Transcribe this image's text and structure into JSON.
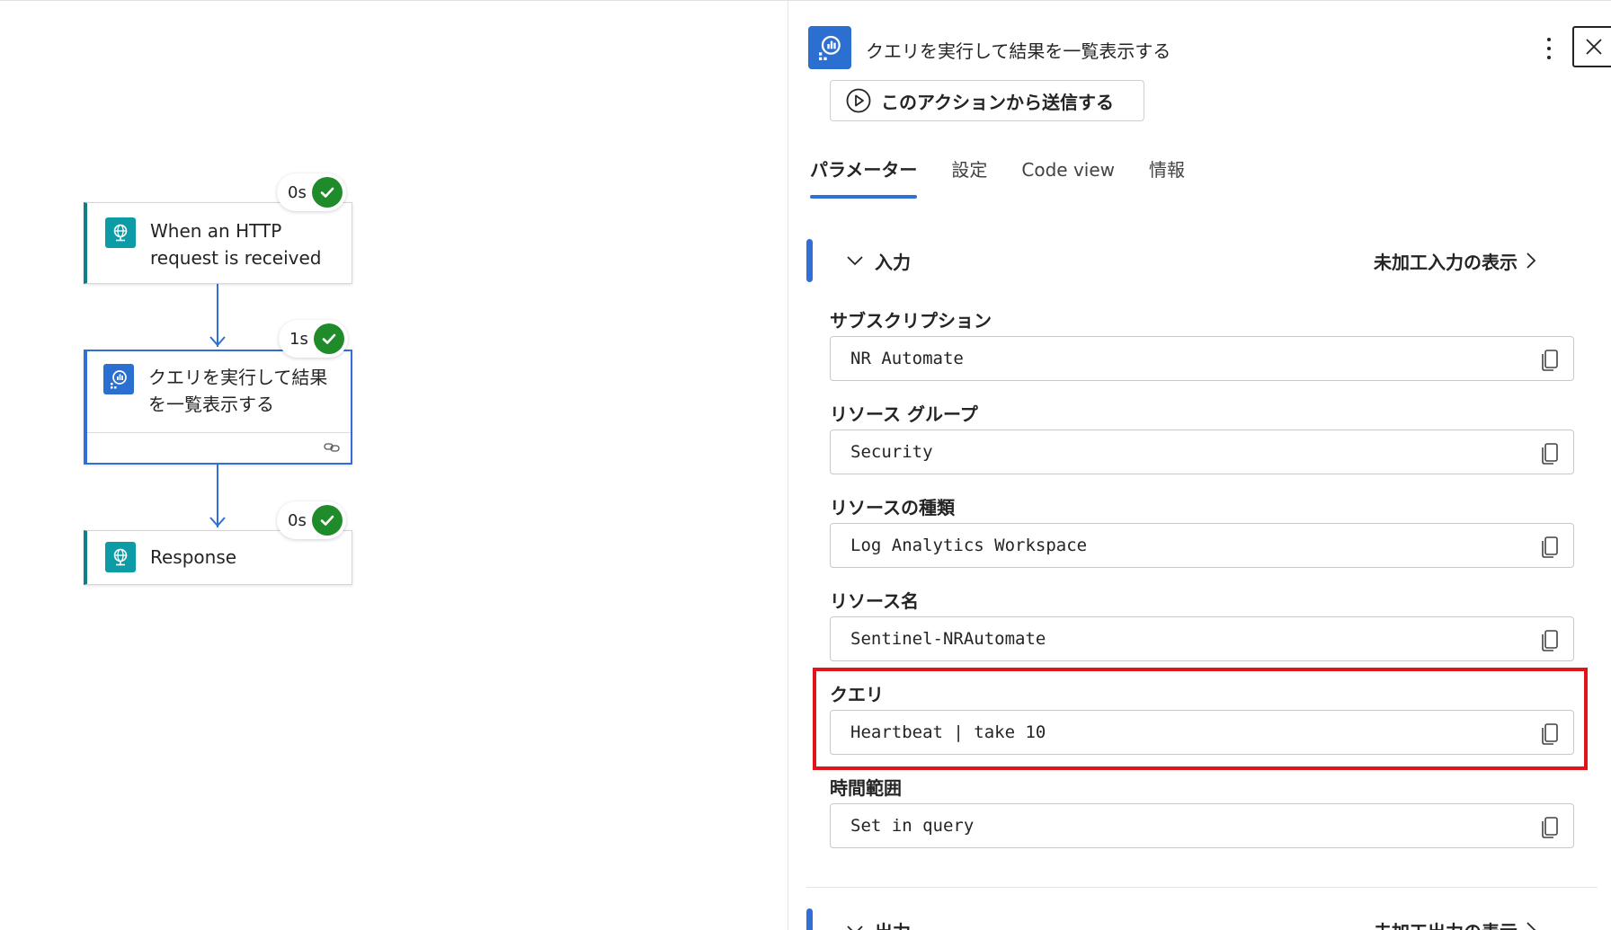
{
  "canvas": {
    "nodes": [
      {
        "title": "When an HTTP request is received",
        "duration": "0s",
        "icon": "globe-icon"
      },
      {
        "title": "クエリを実行して結果を一覧表示する",
        "duration": "1s",
        "icon": "log-analytics-icon"
      },
      {
        "title": "Response",
        "duration": "0s",
        "icon": "globe-icon"
      }
    ]
  },
  "panel": {
    "title": "クエリを実行して結果を一覧表示する",
    "send_button_label": "このアクションから送信する",
    "tabs": [
      "パラメーター",
      "設定",
      "Code view",
      "情報"
    ],
    "active_tab": "パラメーター",
    "input_section": {
      "title": "入力",
      "link": "未加工入力の表示",
      "fields": [
        {
          "label": "サブスクリプション",
          "value": "NR Automate"
        },
        {
          "label": "リソース グループ",
          "value": "Security"
        },
        {
          "label": "リソースの種類",
          "value": "Log Analytics Workspace"
        },
        {
          "label": "リソース名",
          "value": "Sentinel-NRAutomate"
        },
        {
          "label": "クエリ",
          "value": "Heartbeat | take 10"
        },
        {
          "label": "時間範囲",
          "value": "Set in query"
        }
      ]
    },
    "output_section": {
      "title": "出力",
      "link": "未加工出力の表示"
    }
  },
  "colors": {
    "accent": "#2f6fd6",
    "success": "#1f8b2a",
    "highlight": "#e0141b",
    "trigger_teal": "#0d9ba6"
  }
}
